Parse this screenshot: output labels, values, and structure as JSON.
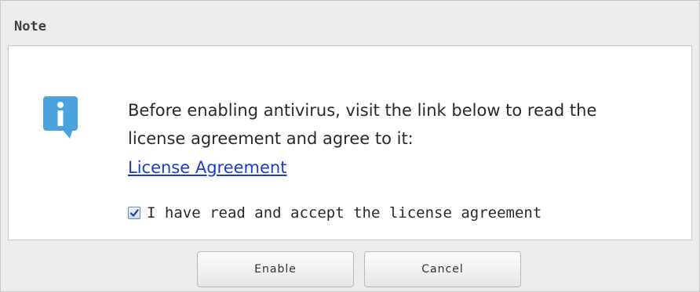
{
  "dialog": {
    "title": "Note",
    "message_lines": [
      "Before enabling antivirus, visit the link below to read the",
      "license agreement and agree to it:"
    ],
    "link_text": "License Agreement",
    "checkbox": {
      "label": "I have read and accept the license agreement",
      "checked": true
    },
    "buttons": {
      "enable": "Enable",
      "cancel": "Cancel"
    },
    "icon": "info-icon",
    "colors": {
      "info_icon": "#4aa3df",
      "link": "#1a3ccf"
    }
  }
}
